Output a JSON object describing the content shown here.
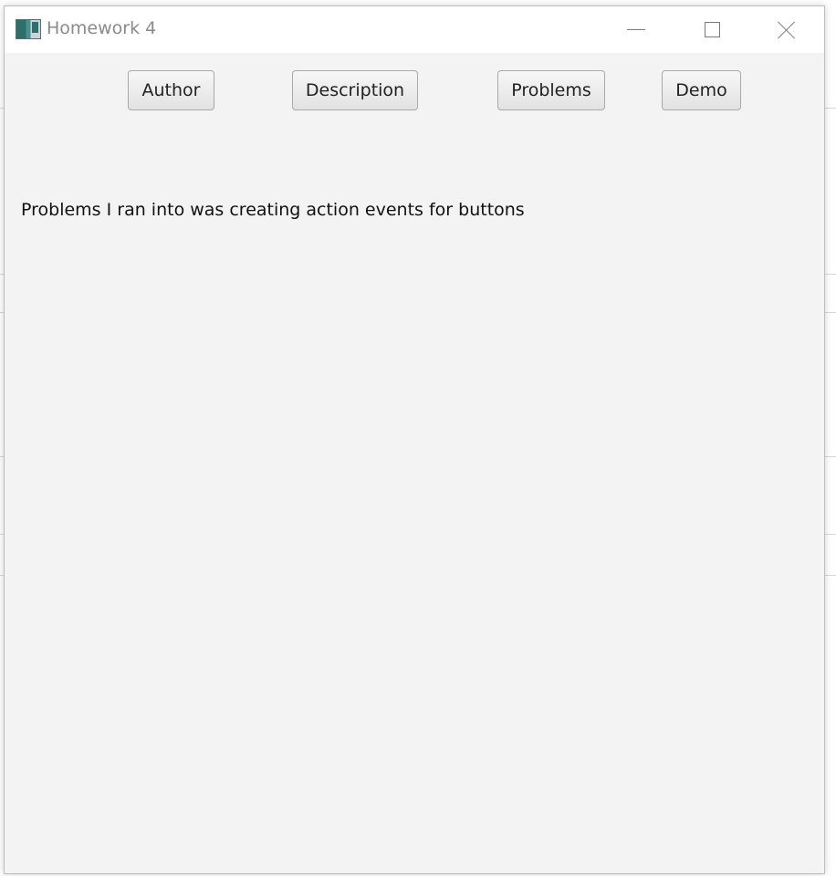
{
  "window": {
    "title": "Homework 4"
  },
  "toolbar": {
    "author_label": "Author",
    "description_label": "Description",
    "problems_label": "Problems",
    "demo_label": "Demo"
  },
  "content": {
    "text": "Problems I ran into was creating action events for buttons"
  },
  "icons": {
    "app": "app-icon",
    "minimize": "minimize-icon",
    "maximize": "maximize-icon",
    "close": "close-icon"
  },
  "colors": {
    "window_bg": "#f3f3f3",
    "titlebar_bg": "#ffffff",
    "button_border": "#a9a9a9",
    "title_text": "#8a8a8a"
  }
}
